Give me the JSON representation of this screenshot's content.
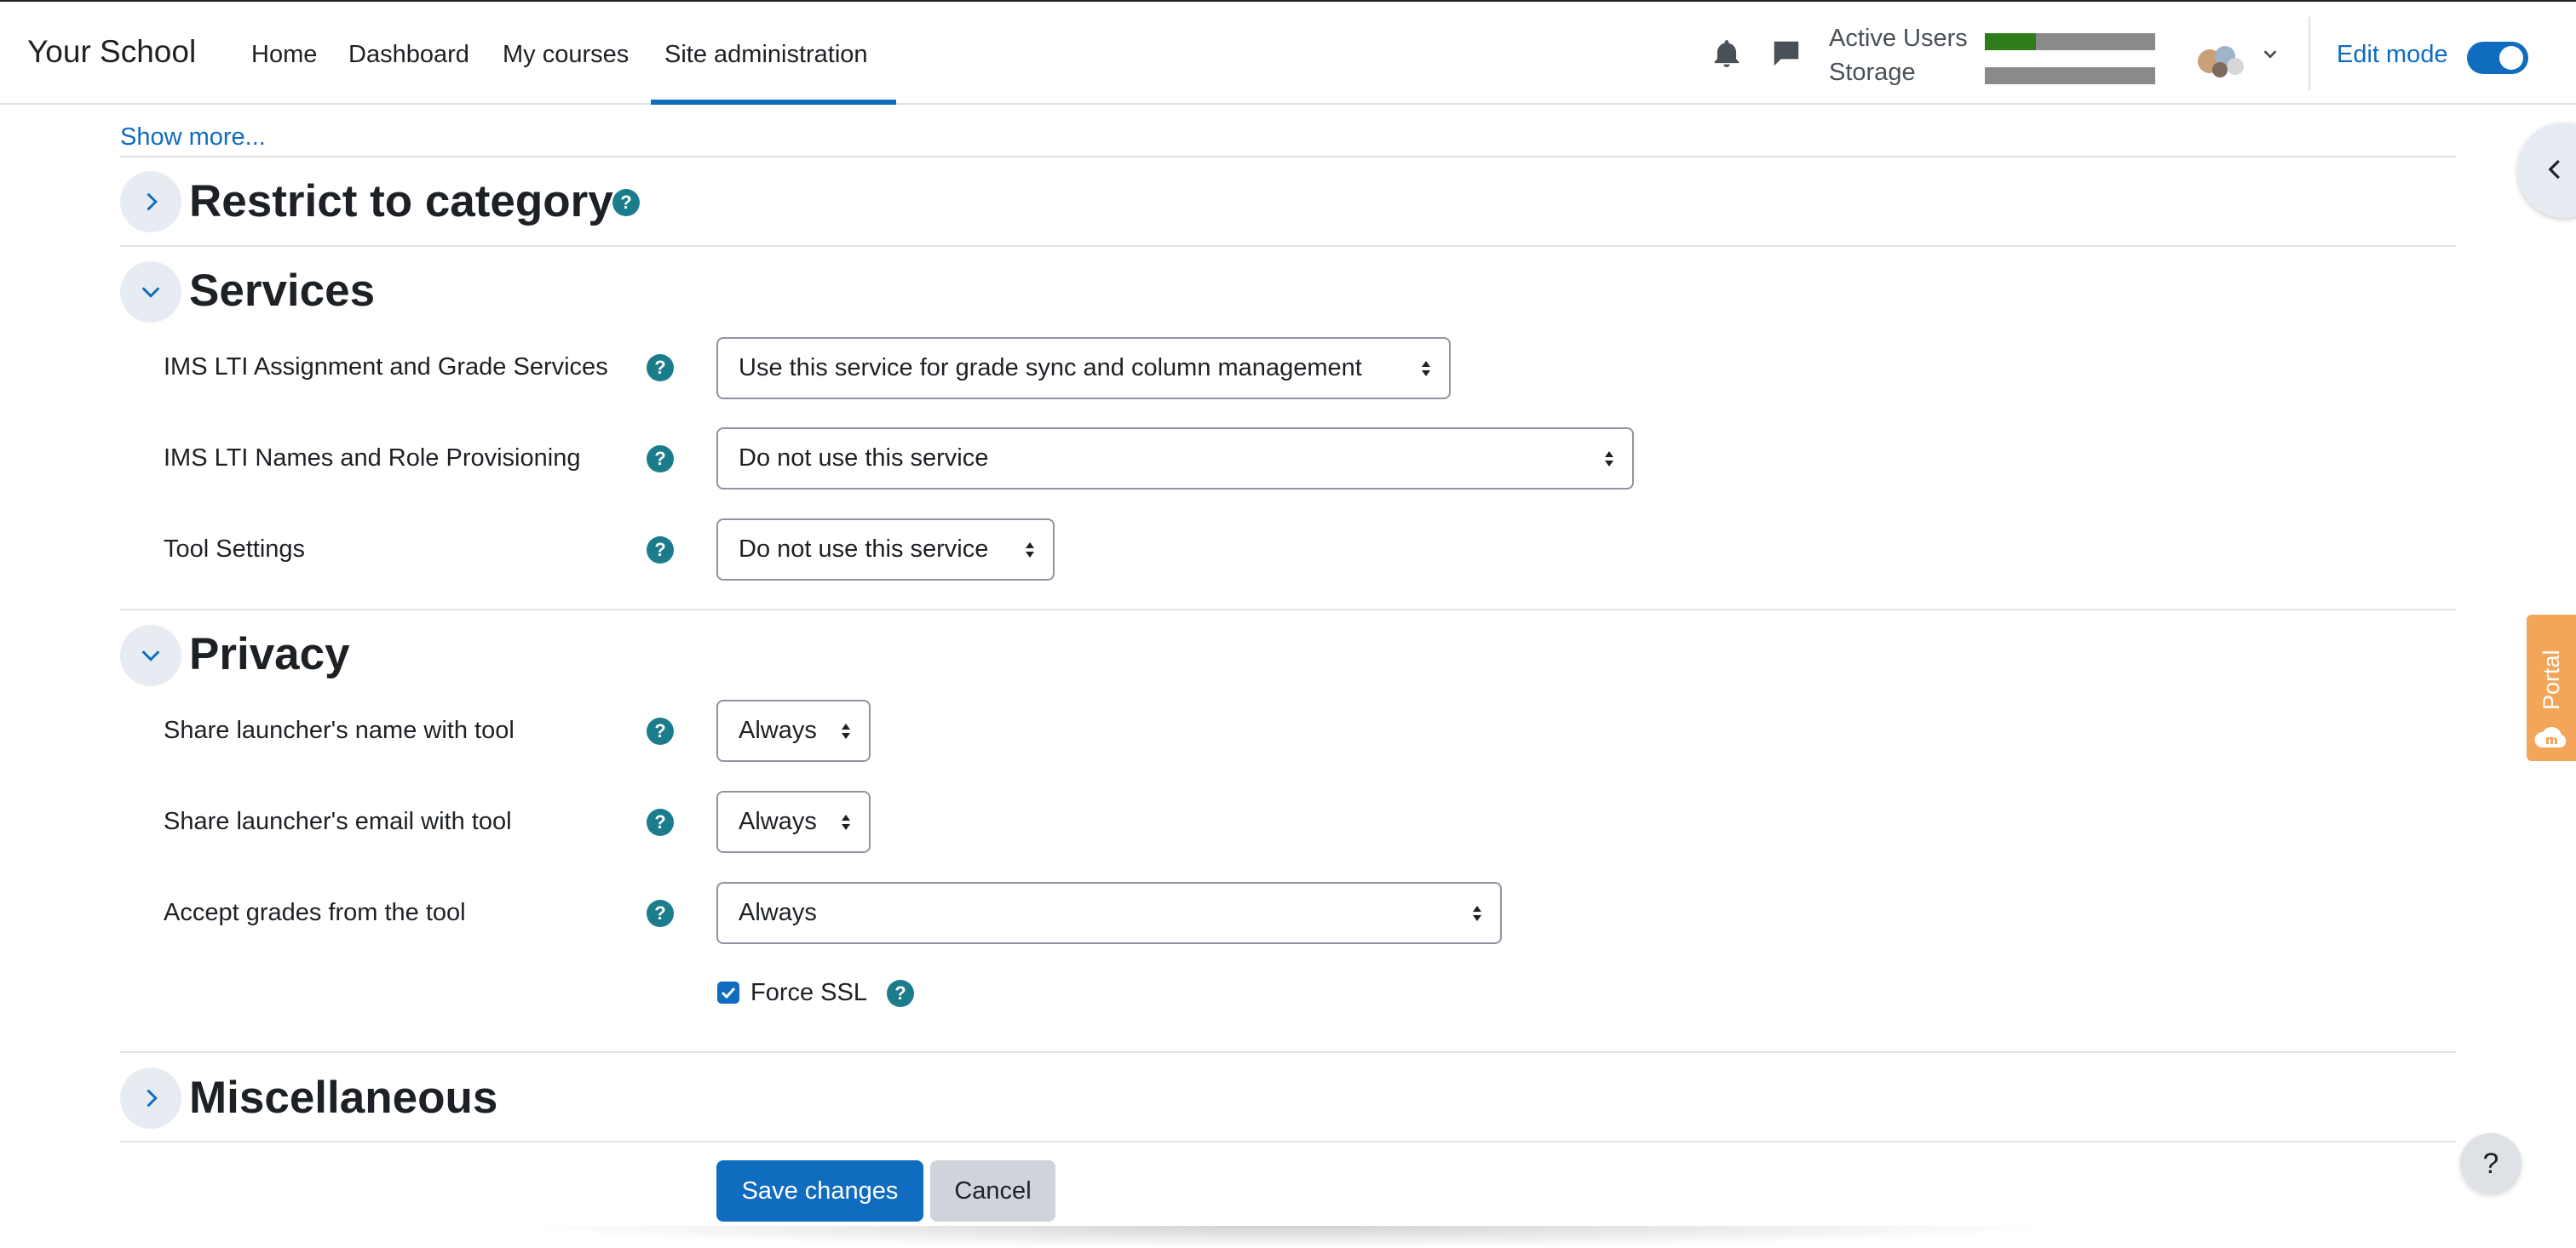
{
  "navbar": {
    "brand": "Your School",
    "links": [
      "Home",
      "Dashboard",
      "My courses",
      "Site administration"
    ],
    "active_link": "Site administration",
    "usage": {
      "active_users_label": "Active Users",
      "active_users_fraction": 0.3,
      "storage_label": "Storage",
      "storage_fraction": 0.0
    },
    "edit_mode_label": "Edit mode",
    "edit_mode_on": true,
    "icons": [
      "bell-icon",
      "chat-icon",
      "chevron-down-icon"
    ]
  },
  "form": {
    "show_more": "Show more...",
    "sections": {
      "restrict": {
        "title": "Restrict to category",
        "expanded": false
      },
      "services": {
        "title": "Services",
        "expanded": true,
        "fields": [
          {
            "label": "IMS LTI Assignment and Grade Services",
            "value": "Use this service for grade sync and column management"
          },
          {
            "label": "IMS LTI Names and Role Provisioning",
            "value": "Do not use this service"
          },
          {
            "label": "Tool Settings",
            "value": "Do not use this service"
          }
        ]
      },
      "privacy": {
        "title": "Privacy",
        "expanded": true,
        "fields": [
          {
            "label": "Share launcher's name with tool",
            "value": "Always"
          },
          {
            "label": "Share launcher's email with tool",
            "value": "Always"
          },
          {
            "label": "Accept grades from the tool",
            "value": "Always"
          }
        ],
        "force_ssl_label": "Force SSL",
        "force_ssl_checked": true
      },
      "misc": {
        "title": "Miscellaneous",
        "expanded": false
      }
    },
    "save_label": "Save changes",
    "cancel_label": "Cancel"
  },
  "help_glyph": "?",
  "side": {
    "portal_label": "Portal",
    "help_fab": "?"
  },
  "colors": {
    "primary": "#0f6cbf",
    "help_badge": "#1b7d8c",
    "usage_fill": "#2e7d1a",
    "portal": "#f3a55a"
  }
}
